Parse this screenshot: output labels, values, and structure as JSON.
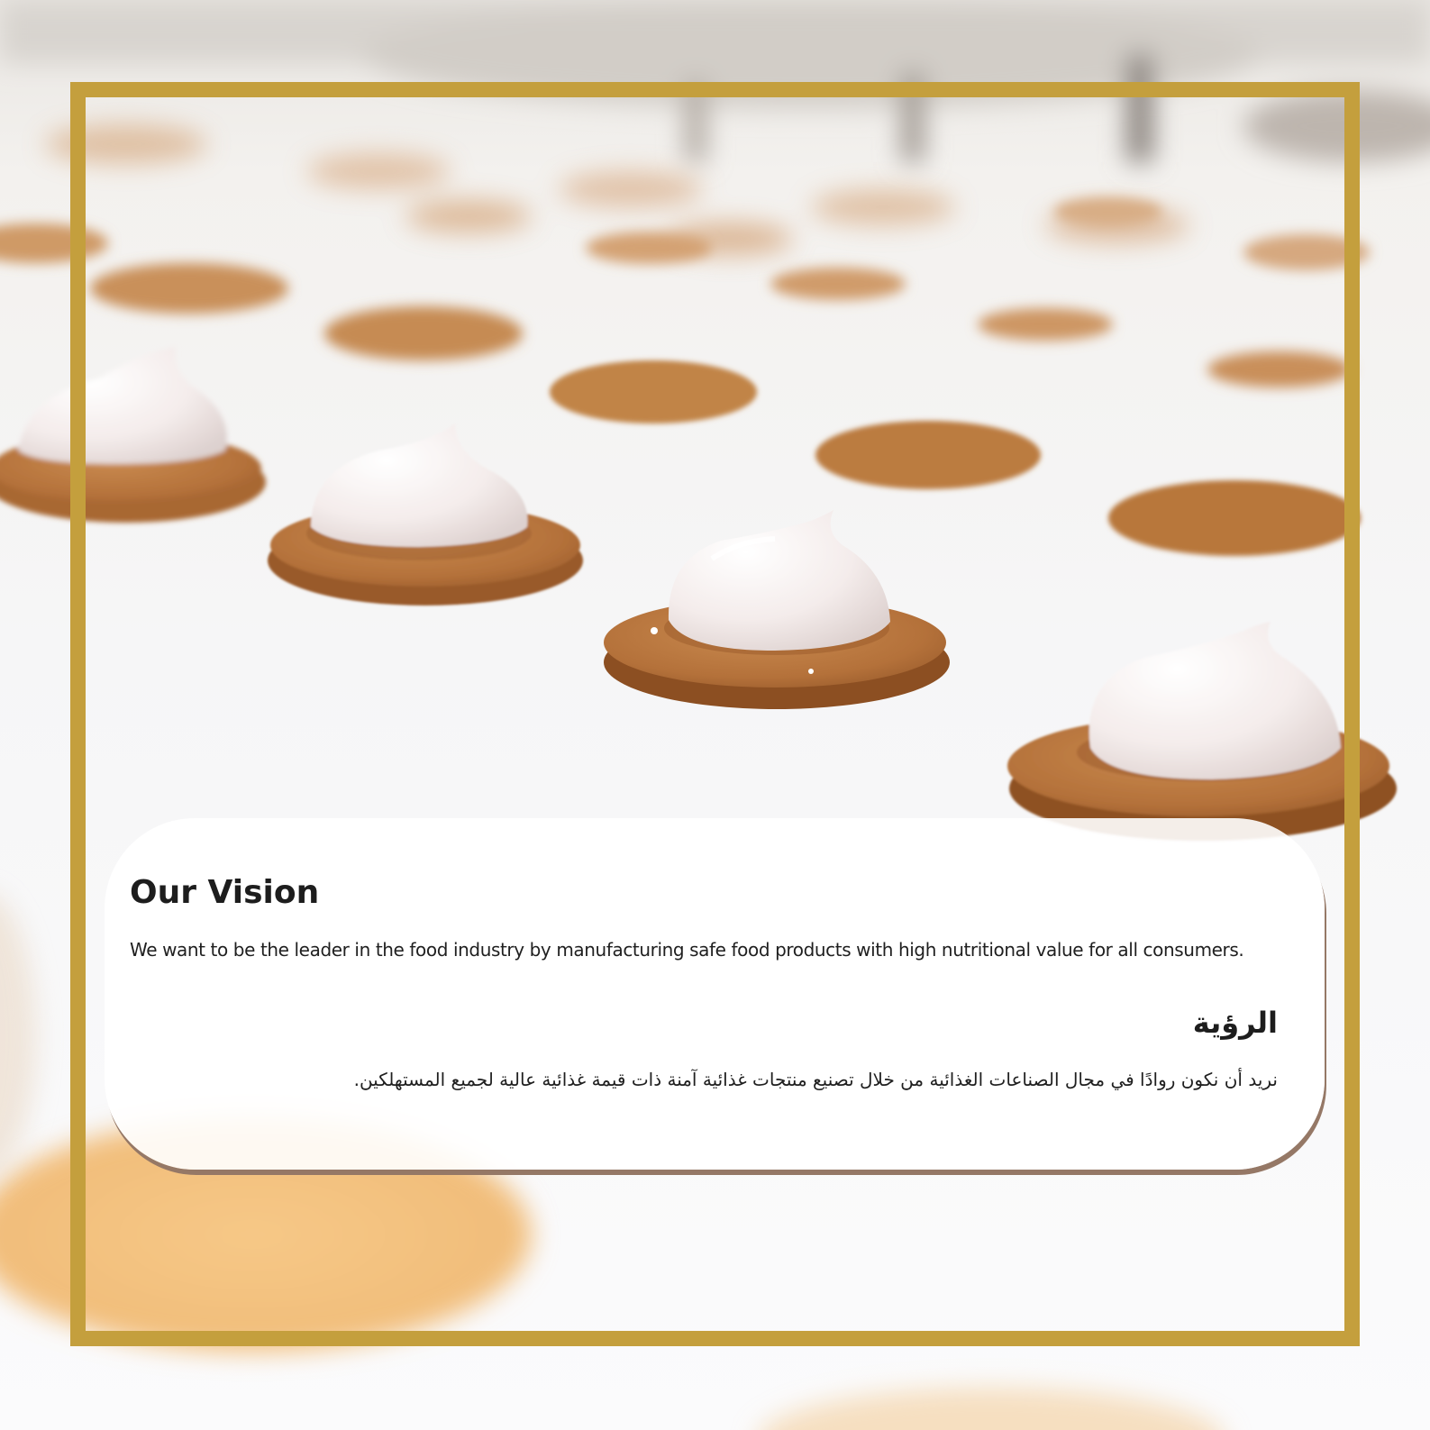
{
  "vision_card": {
    "title_en": "Our Vision",
    "body_en": "We want to be the leader in the food industry by manufacturing safe food products with high nutritional value for all consumers.",
    "title_ar": "الرؤية",
    "body_ar": "نريد أن نكون روادًا في مجال الصناعات الغذائية من خلال تصنيع منتجات غذائية آمنة ذات قيمة غذائية عالية لجميع المستهلكين."
  },
  "colors": {
    "frame_gold": "#c49f3d",
    "card_shadow": "#957866",
    "biscuit": "#b8723a",
    "cream": "#f6efee"
  }
}
